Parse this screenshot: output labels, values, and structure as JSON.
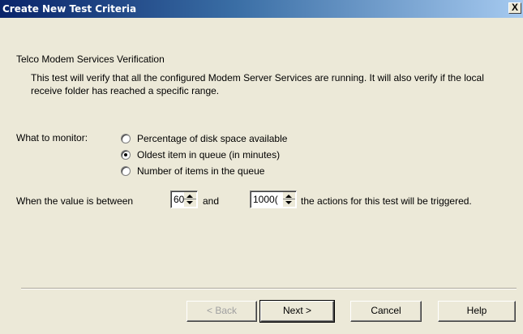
{
  "window": {
    "title": "Create New Test Criteria",
    "close_label": "X"
  },
  "heading": "Telco Modem Services Verification",
  "description": "This test will verify that all the configured Modem Server Services are running. It will also verify if the local receive folder has reached a specific range.",
  "monitor": {
    "label": "What to monitor:",
    "options": [
      {
        "label": "Percentage of disk space available",
        "selected": false
      },
      {
        "label": "Oldest item in queue (in minutes)",
        "selected": true
      },
      {
        "label": "Number of items in the queue",
        "selected": false
      }
    ]
  },
  "range": {
    "prefix": "When the value is between",
    "min_value": "60",
    "and_label": "and",
    "max_value": "1000(",
    "suffix": "the actions for this test will be triggered."
  },
  "buttons": {
    "back": "< Back",
    "next": "Next >",
    "cancel": "Cancel",
    "help": "Help"
  }
}
